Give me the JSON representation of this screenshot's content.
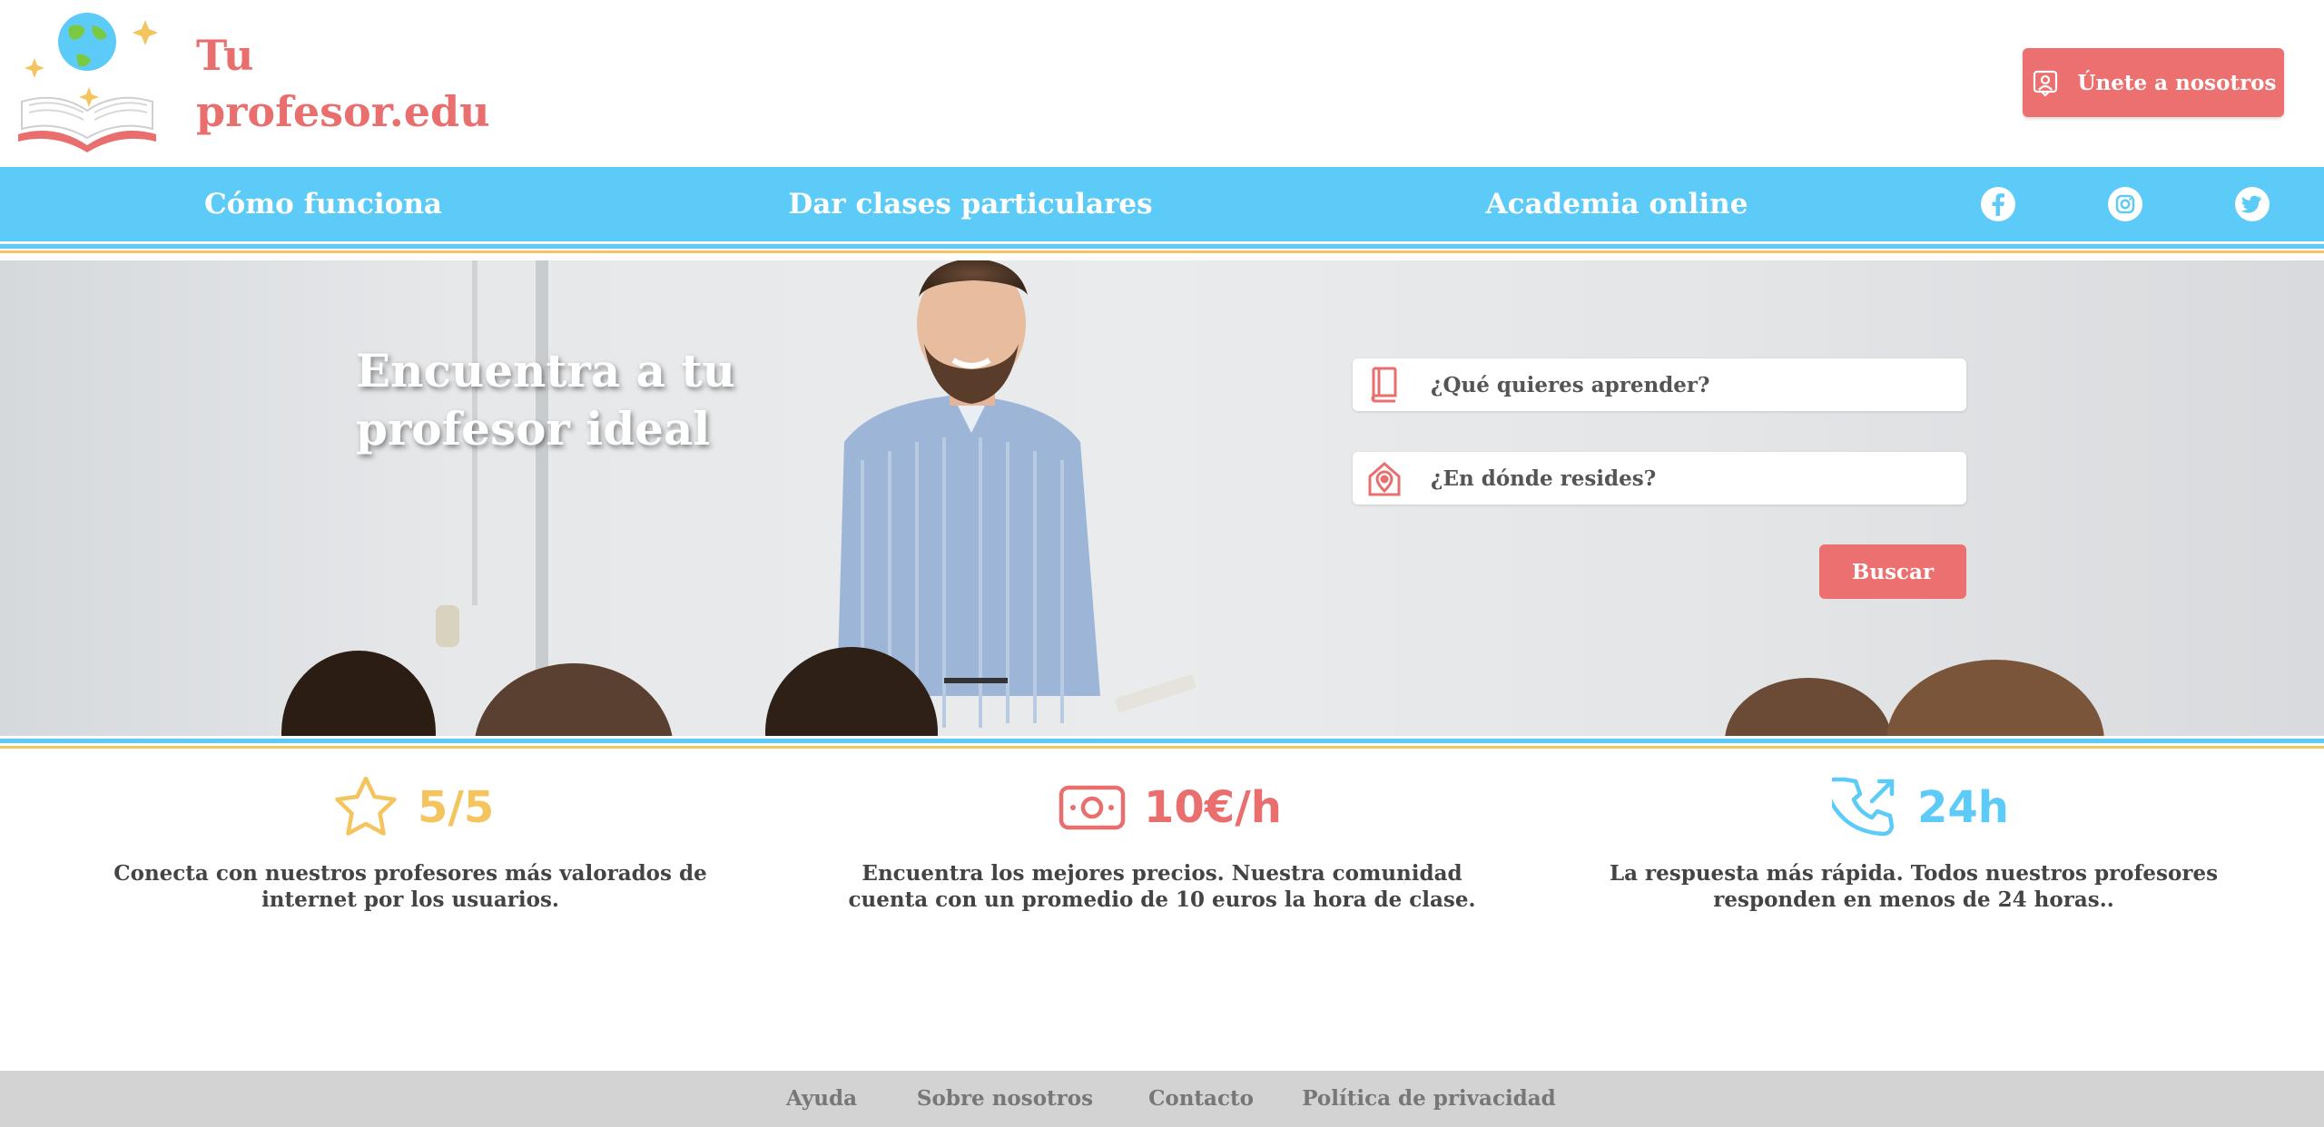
{
  "header": {
    "brand_line1": "Tu",
    "brand_line2": "profesor.edu",
    "join_label": "Únete a nosotros"
  },
  "nav": {
    "items": [
      {
        "label": "Cómo funciona"
      },
      {
        "label": "Dar clases particulares"
      },
      {
        "label": "Academia online"
      }
    ],
    "social": [
      "facebook-icon",
      "instagram-icon",
      "twitter-icon"
    ]
  },
  "hero": {
    "title": "Encuentra a tu profesor ideal",
    "search": {
      "subject_placeholder": "¿Qué quieres aprender?",
      "location_placeholder": "¿En dónde resides?",
      "button_label": "Buscar"
    }
  },
  "stats": [
    {
      "icon": "star-icon",
      "value": "5/5",
      "color": "#f4c45e",
      "text": "Conecta con nuestros profesores más valorados de internet por los usuarios."
    },
    {
      "icon": "money-icon",
      "value": "10€/h",
      "color": "#e96f6f",
      "text": "Encuentra los mejores precios. Nuestra comunidad cuenta con un promedio de 10 euros la hora de clase."
    },
    {
      "icon": "phone-icon",
      "value": "24h",
      "color": "#5ccbf7",
      "text": "La respuesta más rápida. Todos nuestros profesores responden en menos de 24 horas.."
    }
  ],
  "footer": {
    "links": [
      "Ayuda",
      "Sobre nosotros",
      "Contacto",
      "Política de privacidad"
    ]
  },
  "colors": {
    "accent_red": "#ec7070",
    "nav_blue": "#5ccbf7",
    "gold": "#f4c45e"
  }
}
